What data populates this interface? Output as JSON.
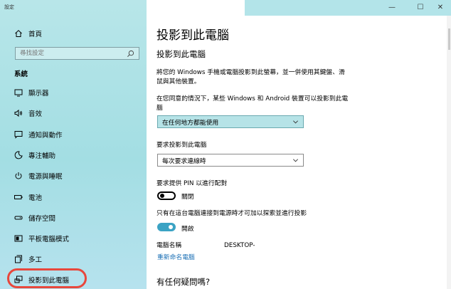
{
  "app": {
    "title": "設定"
  },
  "sidebar": {
    "home": {
      "label": "首頁",
      "icon": "home-icon"
    },
    "search": {
      "placeholder": "尋找設定"
    },
    "section": "系統",
    "items": [
      {
        "label": "顯示器",
        "icon": "monitor-icon"
      },
      {
        "label": "音效",
        "icon": "speaker-icon"
      },
      {
        "label": "通知與動作",
        "icon": "notification-icon"
      },
      {
        "label": "專注輔助",
        "icon": "moon-icon"
      },
      {
        "label": "電源與睡眠",
        "icon": "power-icon"
      },
      {
        "label": "電池",
        "icon": "battery-icon"
      },
      {
        "label": "儲存空間",
        "icon": "storage-icon"
      },
      {
        "label": "平板電腦模式",
        "icon": "tablet-icon"
      },
      {
        "label": "多工",
        "icon": "multitask-icon"
      },
      {
        "label": "投影到此電腦",
        "icon": "project-icon"
      }
    ]
  },
  "window": {
    "minimize": "—",
    "maximize": "☐",
    "close": "✕"
  },
  "main": {
    "title": "投影到此電腦",
    "subtitle": "投影到此電腦",
    "description_line1": "將您的 Windows 手機或電腦投影到此螢幕，並一併使用其鍵盤、滑",
    "description_line2": "鼠與其他裝置。",
    "availability_label_line1": "在您同意的情況下，某些 Windows 和 Android 裝置可以投影到此電",
    "availability_label_line2": "腦",
    "availability_value": "在任何地方都能使用",
    "ask_label": "要求投影到此電腦",
    "ask_value": "每次要求連線時",
    "pin_label": "要求提供 PIN 以進行配對",
    "pin_state": "關閉",
    "power_label": "只有在這台電腦連接到電源時才可加以探索並進行投影",
    "power_state": "開啟",
    "pc_name_label": "電腦名稱",
    "pc_name_value": "DESKTOP-",
    "rename_link": "重新命名電腦",
    "faq_title": "有任何疑問嗎?"
  },
  "colors": {
    "sidebar_bg": "#a3dee3",
    "accent": "#3ba3c4",
    "link": "#1a6fb5",
    "highlight_ring": "#e8473c"
  }
}
